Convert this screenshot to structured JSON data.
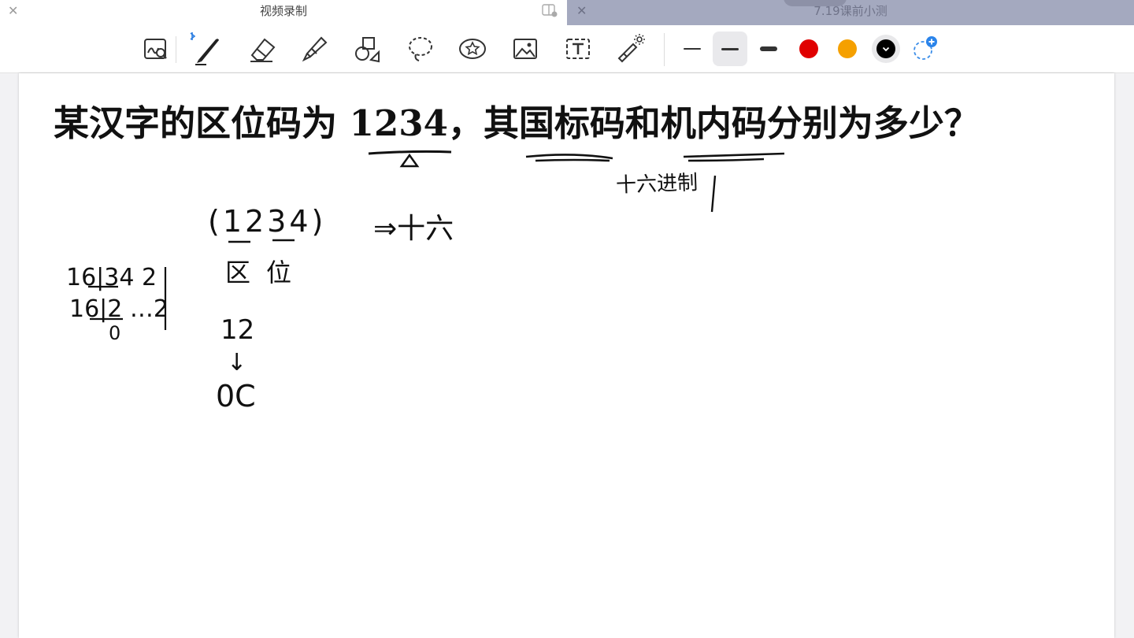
{
  "tabs": [
    {
      "title": "视频录制",
      "close_icon": "close-icon",
      "active": true
    },
    {
      "title": "7.19课前小测",
      "close_icon": "close-icon",
      "active": false
    }
  ],
  "toolbar": {
    "tools": [
      "zoom-writing-icon",
      "bluetooth-pen-icon",
      "eraser-icon",
      "highlighter-icon",
      "shapes-icon",
      "lasso-icon",
      "sticker-icon",
      "image-icon",
      "text-box-icon",
      "laser-pointer-icon"
    ],
    "stroke_widths": [
      "thin",
      "medium",
      "thick"
    ],
    "selected_stroke": "medium",
    "colors": [
      "#e00000",
      "#f5a000",
      "#000000"
    ],
    "selected_color": "#000000",
    "add_color_icon": "add-color-icon"
  },
  "page": {
    "question": "某汉字的区位码为 1234，其国标码和机内码分别为多少？",
    "handwriting": {
      "note_hex": "十六进制",
      "input_code": "(1234)",
      "arrow_to": "⇒十六",
      "zone_label": "区",
      "position_label": "位",
      "value_12": "12",
      "down_arrow": "↓",
      "hex_result": "0C",
      "division_line1": "16|34  2",
      "division_line2": "16|2 …2",
      "division_line3": "0"
    }
  }
}
